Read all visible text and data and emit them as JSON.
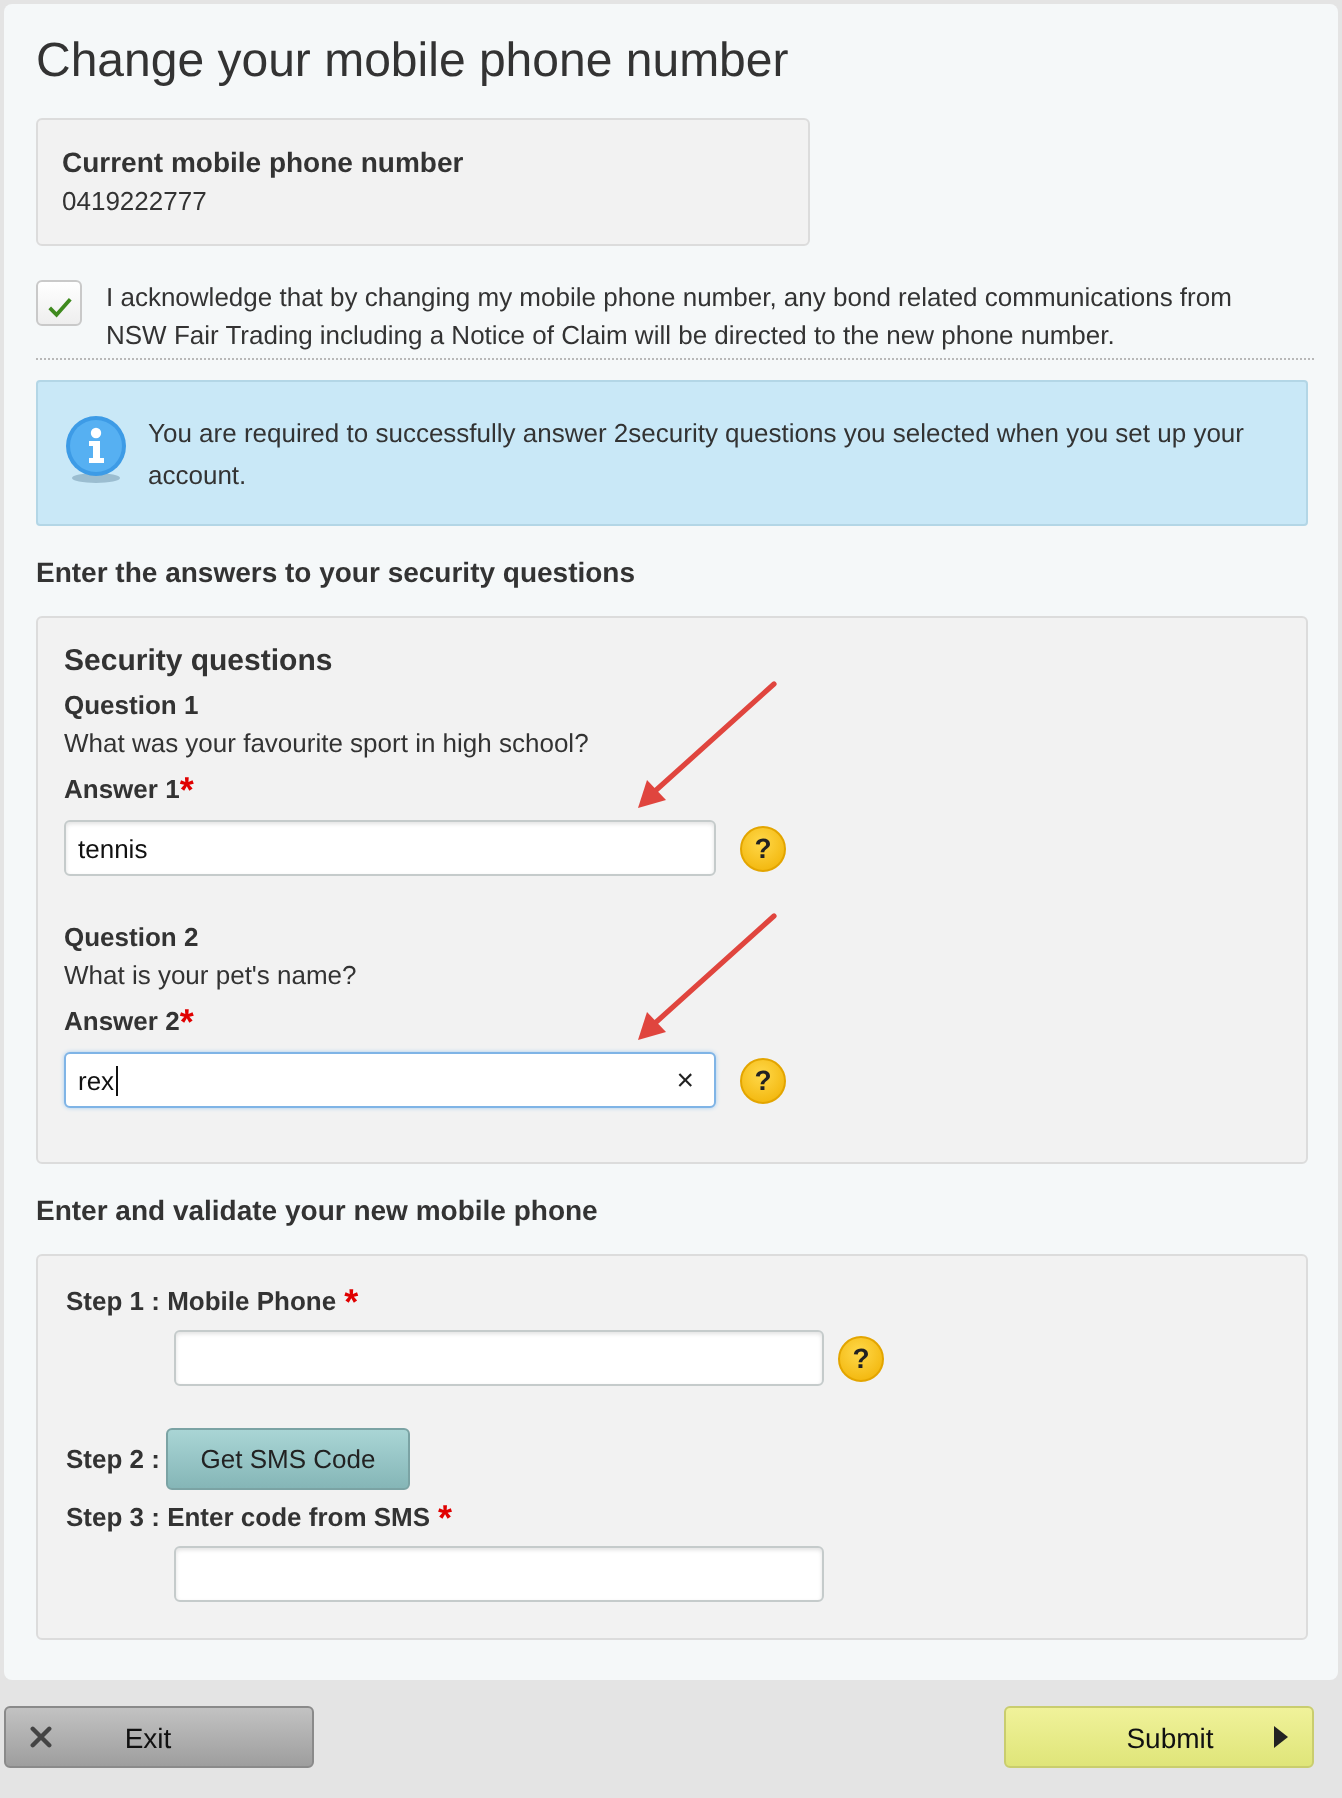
{
  "page": {
    "title": "Change your mobile phone number"
  },
  "current_number": {
    "label": "Current mobile phone number",
    "value": "0419222777"
  },
  "acknowledgement": {
    "checked": true,
    "text": "I acknowledge that by changing my mobile phone number, any bond related communications from NSW Fair Trading including a Notice of Claim will be directed to the new phone number."
  },
  "info_message": {
    "text": "You are required to successfully answer 2security questions you selected when you set up your account."
  },
  "security_section": {
    "heading": "Enter the answers to your security questions",
    "panel_title": "Security questions",
    "questions": [
      {
        "label": "Question 1",
        "question": "What was your favourite sport in high school?",
        "answer_label": "Answer 1",
        "required_mark": "*",
        "value": "tennis",
        "focused": false,
        "help": "?",
        "arrow": true
      },
      {
        "label": "Question 2",
        "question": "What is your pet's name?",
        "answer_label": "Answer 2",
        "required_mark": "*",
        "value": "rex",
        "focused": true,
        "clear_icon": "×",
        "help": "?",
        "arrow": true
      }
    ]
  },
  "phone_section": {
    "heading": "Enter and validate your new mobile phone",
    "steps": [
      {
        "kind": "field",
        "label": "Step 1 : Mobile Phone",
        "required_mark": "*",
        "help": "?"
      },
      {
        "kind": "button",
        "label": "Step 2 :",
        "button": "Get SMS Code"
      },
      {
        "kind": "field",
        "label": "Step 3 : Enter code from SMS",
        "required_mark": "*"
      }
    ]
  },
  "footer": {
    "exit_button": "Exit",
    "submit_button": "Submit"
  }
}
